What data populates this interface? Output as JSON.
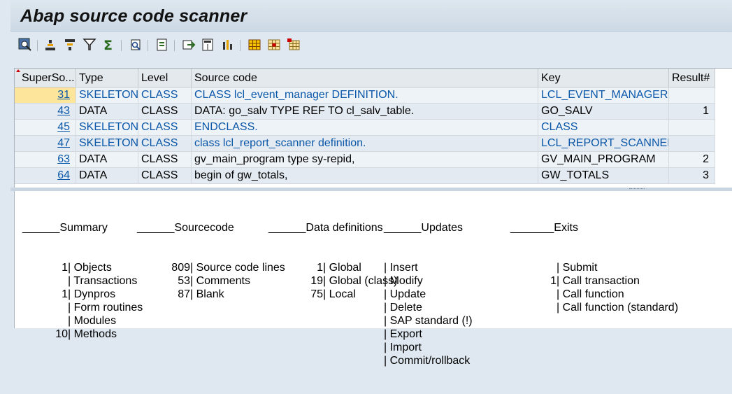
{
  "window": {
    "title": "Abap source code scanner"
  },
  "toolbar": {
    "icons": [
      "details-icon",
      "sort-ascending-icon",
      "sort-descending-icon",
      "filter-icon",
      "total-icon",
      "print-preview-icon",
      "export-icon",
      "local-file-icon",
      "layout-icon",
      "chart-icon",
      "grid-icon",
      "grid-select-icon",
      "grid-expand-icon"
    ]
  },
  "grid": {
    "headers": [
      "SuperSo...",
      "Type",
      "Level",
      "Source code",
      "Key",
      "Result#"
    ],
    "rows": [
      {
        "line": "31",
        "type": "SKELETON",
        "level": "CLASS",
        "source": "CLASS lcl_event_manager DEFINITION.",
        "key": "LCL_EVENT_MANAGER",
        "result": "",
        "style": "link"
      },
      {
        "line": "43",
        "type": "DATA",
        "level": "CLASS",
        "source": "DATA: go_salv TYPE REF TO cl_salv_table.",
        "key": "GO_SALV",
        "result": "1",
        "style": "black"
      },
      {
        "line": "45",
        "type": "SKELETON",
        "level": "CLASS",
        "source": "ENDCLASS.",
        "key": "CLASS",
        "result": "",
        "style": "link"
      },
      {
        "line": "47",
        "type": "SKELETON",
        "level": "CLASS",
        "source": "class lcl_report_scanner definition.",
        "key": "LCL_REPORT_SCANNER",
        "result": "",
        "style": "link"
      },
      {
        "line": "63",
        "type": "DATA",
        "level": "CLASS",
        "source": "gv_main_program type sy-repid,",
        "key": "GV_MAIN_PROGRAM",
        "result": "2",
        "style": "black"
      },
      {
        "line": "64",
        "type": "DATA",
        "level": "CLASS",
        "source": "begin of gw_totals,",
        "key": "GW_TOTALS",
        "result": "3",
        "style": "black"
      }
    ]
  },
  "summary": {
    "c1": {
      "header": "______Summary",
      "lines": [
        "1| Objects",
        "| Transactions",
        "1| Dynpros",
        "| Form routines",
        "| Modules",
        "10| Methods"
      ]
    },
    "c2": {
      "header": "______Sourcecode",
      "lines": [
        "809| Source code lines",
        "53| Comments",
        "87| Blank"
      ]
    },
    "c3": {
      "header": "______Data definitions",
      "lines": [
        "1| Global",
        "19| Global (class)",
        "75| Local"
      ]
    },
    "c4": {
      "header": "______Updates",
      "lines": [
        "| Insert",
        "| Modify",
        "| Update",
        "| Delete",
        "| SAP standard (!)",
        "| Export",
        "| Import",
        "| Commit/rollback"
      ]
    },
    "c5": {
      "header": "_______Exits",
      "lines": [
        "| Submit",
        "1| Call transaction",
        "| Call function",
        "| Call function (standard)"
      ]
    }
  }
}
